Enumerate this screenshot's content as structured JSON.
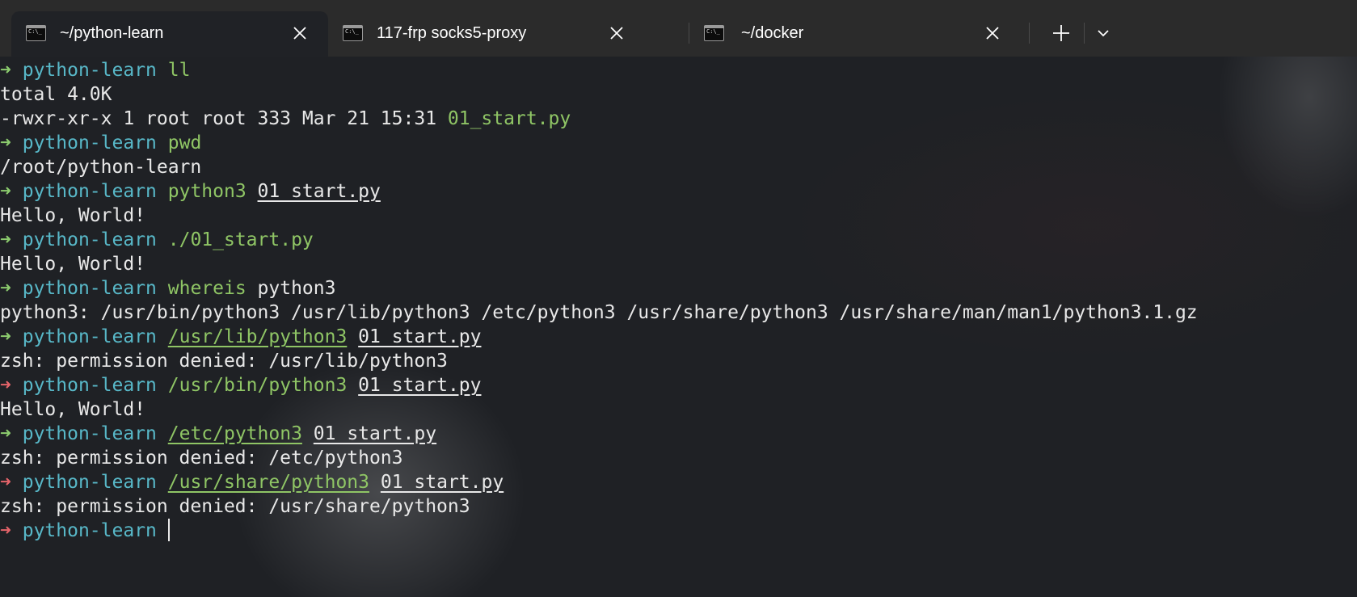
{
  "tabs": [
    {
      "title": "~/python-learn",
      "icon": "terminal-icon",
      "active": true
    },
    {
      "title": "117-frp socks5-proxy",
      "icon": "terminal-icon",
      "active": false
    },
    {
      "title": "~/docker",
      "icon": "terminal-icon",
      "active": false
    }
  ],
  "tab_icon_glyph": "C:\\_",
  "tabbar_buttons": {
    "new_tab": "plus-icon",
    "dropdown": "chevron-down-icon"
  },
  "prompt": {
    "arrow": "➜",
    "dir": "python-learn"
  },
  "colors": {
    "arrow_success": "#8ccc6e",
    "arrow_error": "#e5646a",
    "prompt_dir": "#58b8c8",
    "command": "#8fc565",
    "text": "#e8e8e8",
    "tabbar": "#2b2b2b",
    "background": "#1f2125"
  },
  "lines": [
    {
      "type": "prompt",
      "status": "ok",
      "cmd": "ll",
      "args": ""
    },
    {
      "type": "output",
      "text": "total 4.0K"
    },
    {
      "type": "output-file",
      "text": "-rwxr-xr-x 1 root root 333 Mar 21 15:31 ",
      "file": "01_start.py"
    },
    {
      "type": "prompt",
      "status": "ok",
      "cmd": "pwd",
      "args": ""
    },
    {
      "type": "output",
      "text": "/root/python-learn"
    },
    {
      "type": "prompt",
      "status": "ok",
      "cmd": "python3",
      "args": "01_start.py"
    },
    {
      "type": "output",
      "text": "Hello, World!"
    },
    {
      "type": "prompt",
      "status": "ok",
      "cmd": "./01_start.py",
      "args": ""
    },
    {
      "type": "output",
      "text": "Hello, World!"
    },
    {
      "type": "prompt",
      "status": "ok",
      "cmd": "whereis",
      "args_plain": "python3"
    },
    {
      "type": "output",
      "text": "python3: /usr/bin/python3 /usr/lib/python3 /etc/python3 /usr/share/python3 /usr/share/man/man1/python3.1.gz"
    },
    {
      "type": "prompt",
      "status": "ok",
      "cmd_path": "/usr/lib/python3",
      "args": "01_start.py"
    },
    {
      "type": "output",
      "text": "zsh: permission denied: /usr/lib/python3"
    },
    {
      "type": "prompt",
      "status": "error",
      "cmd": "/usr/bin/python3",
      "args": "01_start.py"
    },
    {
      "type": "output",
      "text": "Hello, World!"
    },
    {
      "type": "prompt",
      "status": "ok",
      "cmd_path": "/etc/python3",
      "args": "01_start.py"
    },
    {
      "type": "output",
      "text": "zsh: permission denied: /etc/python3"
    },
    {
      "type": "prompt",
      "status": "error",
      "cmd_path": "/usr/share/python3",
      "args": "01_start.py"
    },
    {
      "type": "output",
      "text": "zsh: permission denied: /usr/share/python3"
    },
    {
      "type": "prompt-current",
      "status": "error"
    }
  ]
}
